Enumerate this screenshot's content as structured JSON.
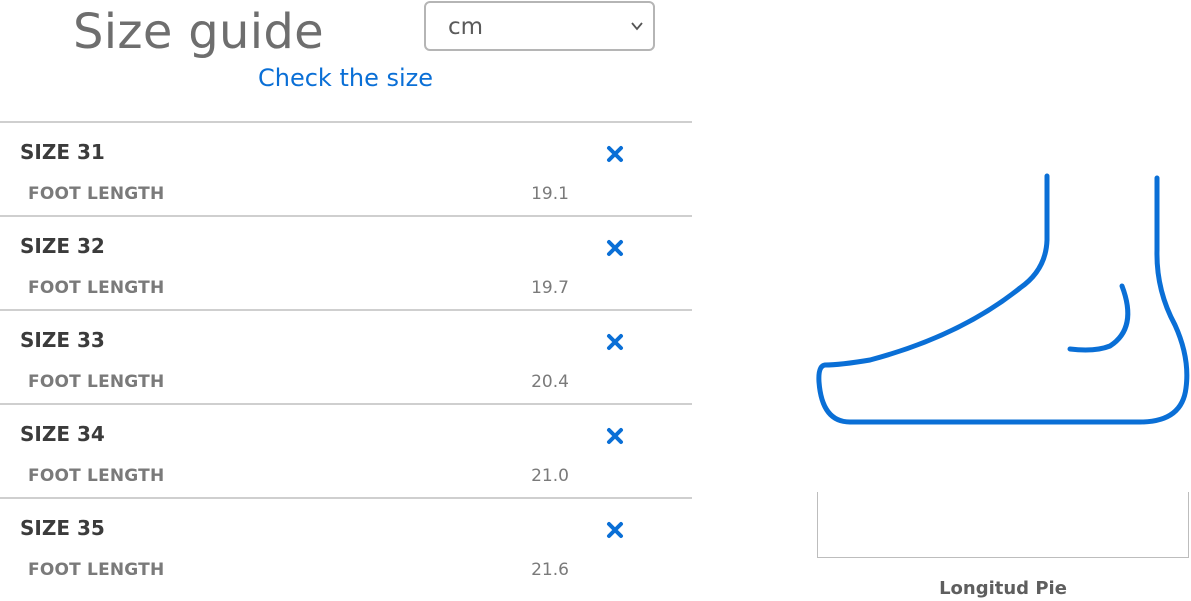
{
  "header": {
    "title": "Size guide",
    "unit_select": {
      "selected": "cm"
    },
    "check_link": "Check the size"
  },
  "sizes": [
    {
      "size": "SIZE 31",
      "label": "FOOT LENGTH",
      "value": "19.1"
    },
    {
      "size": "SIZE 32",
      "label": "FOOT LENGTH",
      "value": "19.7"
    },
    {
      "size": "SIZE 33",
      "label": "FOOT LENGTH",
      "value": "20.4"
    },
    {
      "size": "SIZE 34",
      "label": "FOOT LENGTH",
      "value": "21.0"
    },
    {
      "size": "SIZE 35",
      "label": "FOOT LENGTH",
      "value": "21.6"
    }
  ],
  "illustration": {
    "icon": "foot-outline-icon",
    "measure_label": "Longitud Pie"
  },
  "colors": {
    "accent": "#0a6fd6",
    "title": "#6e6e6e",
    "divider": "#cfcfcf"
  }
}
